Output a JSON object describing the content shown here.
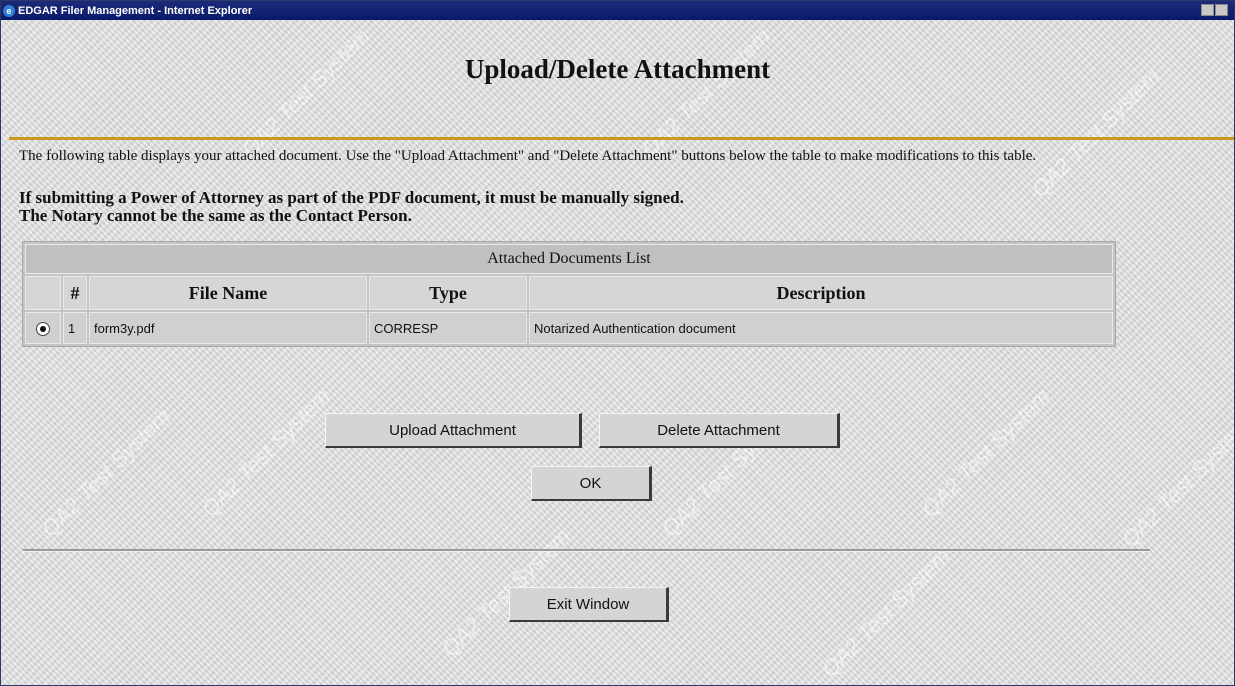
{
  "window": {
    "title": "EDGAR Filer Management - Internet Explorer"
  },
  "page": {
    "heading": "Upload/Delete Attachment",
    "intro": "The following table displays your attached document.  Use the \"Upload Attachment\" and \"Delete Attachment\" buttons below the table to make modifications to this table.",
    "notice_line1": "If submitting a Power of Attorney as part of the PDF document, it must be manually signed.",
    "notice_line2": "The Notary cannot be the same as the Contact Person."
  },
  "table": {
    "caption": "Attached Documents List",
    "headers": {
      "select": "",
      "num": "#",
      "file_name": "File Name",
      "type": "Type",
      "description": "Description"
    },
    "rows": [
      {
        "selected": true,
        "num": "1",
        "file_name": "form3y.pdf",
        "type": "CORRESP",
        "description": "Notarized Authentication document"
      }
    ]
  },
  "buttons": {
    "upload": "Upload Attachment",
    "delete": "Delete Attachment",
    "ok": "OK",
    "exit": "Exit Window"
  },
  "watermark_text": "QA2 Test System",
  "colors": {
    "title_bar": "#0a1a6a",
    "accent_rule": "#c79a1a",
    "background": "#dadada"
  }
}
